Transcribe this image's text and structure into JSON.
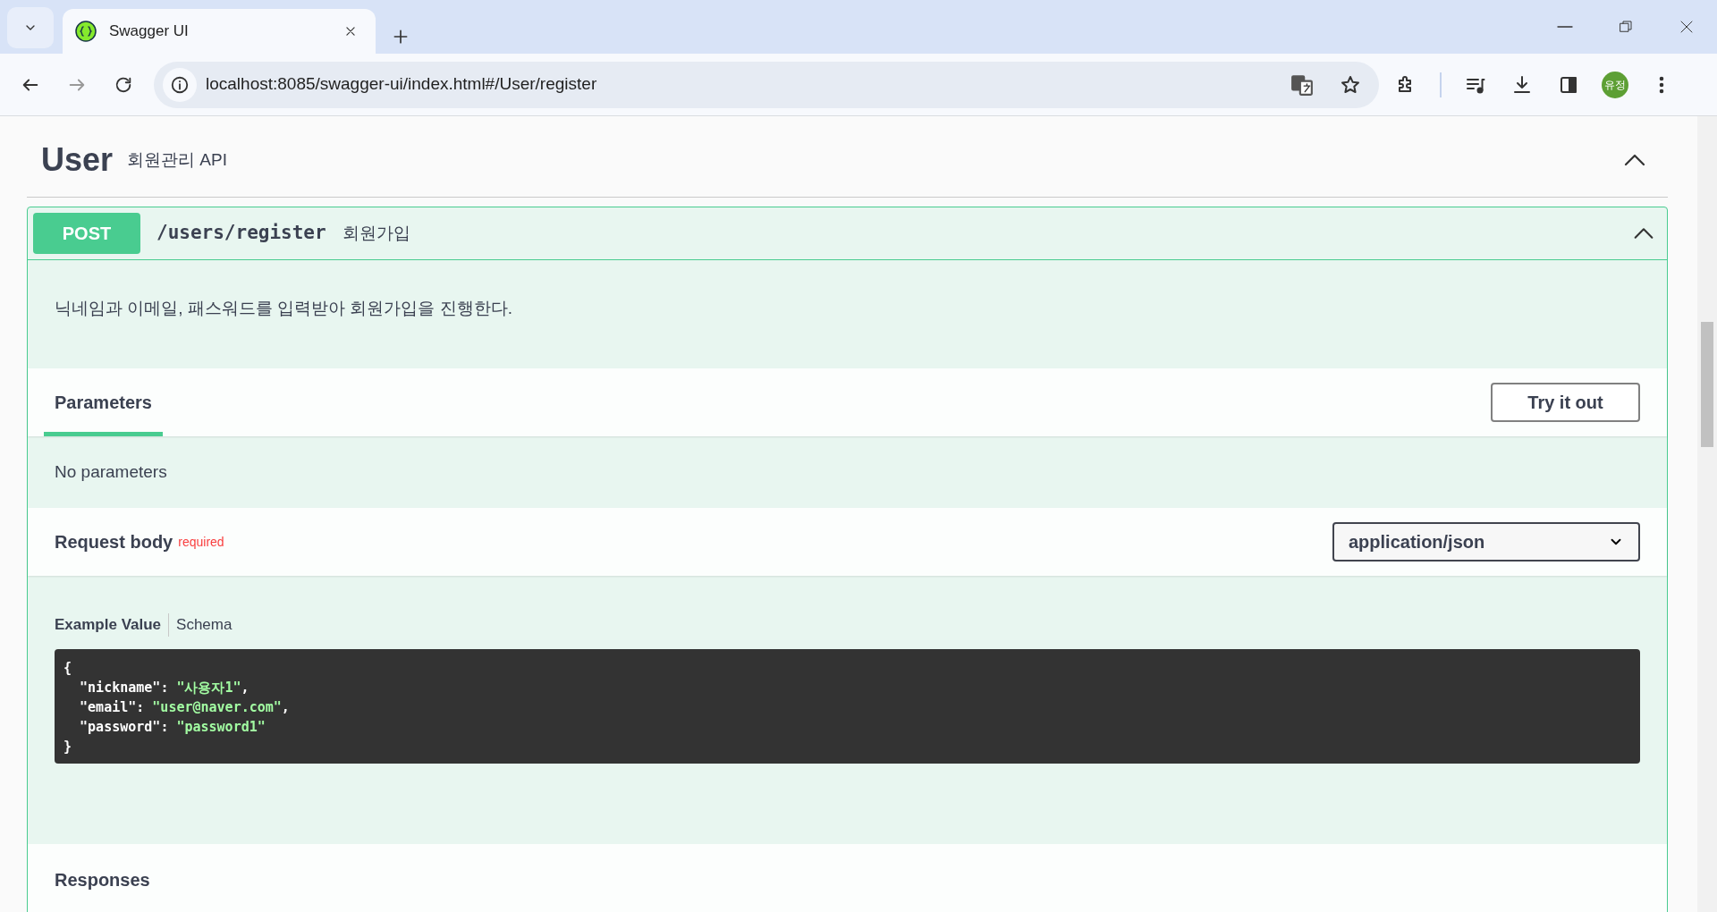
{
  "browser": {
    "tabs": [
      {
        "title": "Swagger UI",
        "selected": true
      }
    ],
    "url": "localhost:8085/swagger-ui/index.html#/User/register",
    "profile": "유정"
  },
  "tag": {
    "name": "User",
    "description": "회원관리 API",
    "expanded": true
  },
  "operation": {
    "method": "POST",
    "path": "/users/register",
    "summary": "회원가입",
    "expanded": true,
    "description": "닉네임과 이메일, 패스워드를 입력받아 회원가입을 진행한다.",
    "parameters": {
      "title": "Parameters",
      "button": "Try it out",
      "empty": "No parameters"
    },
    "request_body": {
      "title": "Request body",
      "required": "required",
      "content_type": "application/json",
      "tabs": [
        {
          "label": "Example Value",
          "selected": true
        },
        {
          "label": "Schema",
          "selected": false
        }
      ],
      "code": [
        [
          {
            "t": "{",
            "kind": "punct"
          }
        ],
        [
          {
            "t": "  \"nickname\"",
            "kind": "key"
          },
          {
            "t": ": ",
            "kind": "punct"
          },
          {
            "t": "\"사용자1\"",
            "kind": "string"
          },
          {
            "t": ",",
            "kind": "punct"
          }
        ],
        [
          {
            "t": "  \"email\"",
            "kind": "key"
          },
          {
            "t": ": ",
            "kind": "punct"
          },
          {
            "t": "\"user@naver.com\"",
            "kind": "string"
          },
          {
            "t": ",",
            "kind": "punct"
          }
        ],
        [
          {
            "t": "  \"password\"",
            "kind": "key"
          },
          {
            "t": ": ",
            "kind": "punct"
          },
          {
            "t": "\"password1\"",
            "kind": "string"
          }
        ],
        [
          {
            "t": "}",
            "kind": "punct"
          }
        ]
      ]
    },
    "responses": {
      "title": "Responses"
    }
  }
}
